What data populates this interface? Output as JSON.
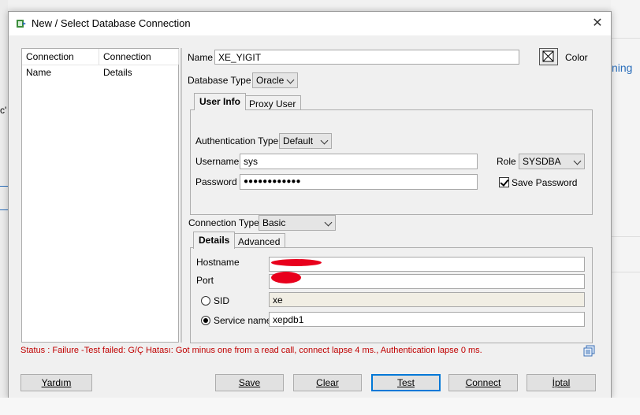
{
  "background": {
    "link_fragment": "ning",
    "text_fragment": "c'"
  },
  "dialog": {
    "title": "New / Select Database Connection",
    "close_glyph": "✕"
  },
  "connections_table": {
    "columns": [
      "Connection Name",
      "Connection Details"
    ]
  },
  "form": {
    "name_label": "Name",
    "name_value": "XE_YIGIT",
    "color_label": "Color",
    "db_type_label": "Database Type",
    "db_type_value": "Oracle",
    "tabs": [
      "User Info",
      "Proxy User"
    ],
    "auth_type_label": "Authentication Type",
    "auth_type_value": "Default",
    "username_label": "Username",
    "username_value": "sys",
    "role_label": "Role",
    "role_value": "SYSDBA",
    "password_label": "Password",
    "password_value": "●●●●●●●●●●●●",
    "save_password_label": "Save Password",
    "save_password_checked": true,
    "conn_type_label": "Connection Type",
    "conn_type_value": "Basic",
    "conn_tabs": [
      "Details",
      "Advanced"
    ],
    "hostname_label": "Hostname",
    "hostname_value": "",
    "port_label": "Port",
    "port_value": "",
    "sid_label": "SID",
    "sid_value": "xe",
    "service_name_label": "Service name",
    "service_name_value": "xepdb1"
  },
  "status": {
    "text": "Status : Failure -Test failed: G/Ç Hatası: Got minus one from a read call, connect lapse 4 ms., Authentication lapse 0 ms.",
    "color": "#c00000"
  },
  "buttons": {
    "help": "Yardım",
    "save": "Save",
    "clear": "Clear",
    "test": "Test",
    "connect": "Connect",
    "cancel": "İptal"
  }
}
